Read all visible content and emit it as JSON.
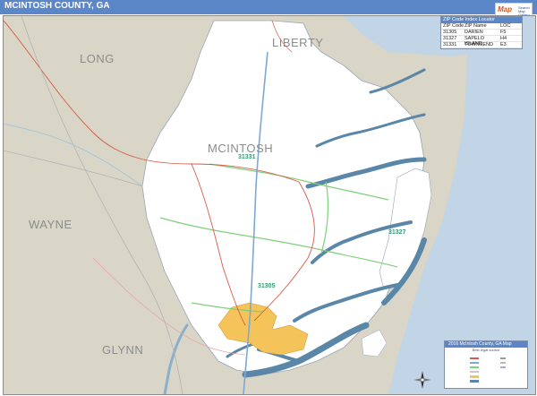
{
  "title": "MCINTOSH COUNTY, GA",
  "logo": {
    "brand": "Map",
    "sub_line1": "Search",
    "sub_line2": "Map",
    "sub_line3": "Gallery"
  },
  "regions": {
    "long": "LONG",
    "liberty": "LIBERTY",
    "mcintosh": "MCINTOSH",
    "wayne": "WAYNE",
    "glynn": "GLYNN"
  },
  "zip_labels": {
    "z31331": "31331",
    "z31327": "31327",
    "z31305": "31305"
  },
  "zip_table": {
    "title": "ZIP Code Index Locator",
    "headers": [
      "ZIP Code",
      "ZIP Name",
      "LOC"
    ],
    "rows": [
      {
        "zip": "31305",
        "name": "DARIEN",
        "loc": "F5"
      },
      {
        "zip": "31327",
        "name": "SAPELO ISLAND",
        "loc": "H4"
      },
      {
        "zip": "31331",
        "name": "TOWNSEND",
        "loc": "E3"
      }
    ]
  },
  "legend": {
    "title": "2016 McIntosh County, GA Map",
    "subtitle": "Best legal source"
  },
  "colors": {
    "title_bar": "#5b87c9",
    "land_inside": "#ffffff",
    "land_outside": "#d9d5c7",
    "water": "#5a86a8",
    "zip_boundary": "#7fd07a",
    "county_boundary": "#c9c9c9",
    "highway": "#d75a4a",
    "interstate": "#7fa7d6",
    "urban": "#f4c35a"
  }
}
